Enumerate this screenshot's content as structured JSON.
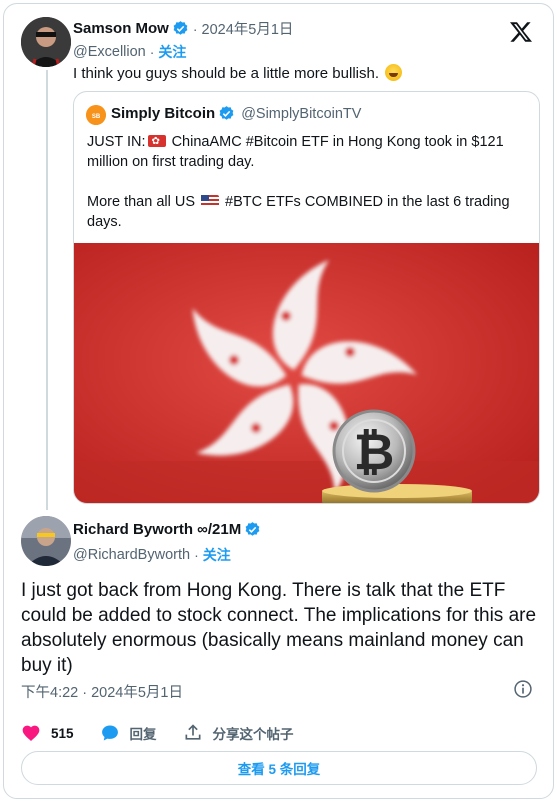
{
  "tweet": {
    "author_name": "Samson Mow",
    "author_handle": "@Excellion",
    "date": "2024年5月1日",
    "follow_label": "关注",
    "text": "I think you guys should be a little more bullish.",
    "emoji": "face-with-tears-of-joy"
  },
  "quoted_tweet": {
    "author_name": "Simply Bitcoin",
    "author_handle": "@SimplyBitcoinTV",
    "line1_pre": "JUST IN:",
    "line1_post": " ChinaAMC #Bitcoin ETF in Hong Kong took in $121",
    "line2": "million on first trading day.",
    "line3_pre": "More than all US ",
    "line3_post": " #BTC ETFs COMBINED in the last 6 trading",
    "line4": "days.",
    "image_description_icon": "hong-kong-flag-with-bitcoin"
  },
  "reply": {
    "author_name": "Richard Byworth ∞/21M",
    "author_handle": "@RichardByworth",
    "follow_label": "关注",
    "text": "I just got back from Hong Kong. There is talk that the ETF could be added to stock connect. The implications for this are absolutely enormous (basically means mainland money can buy it)",
    "timestamp": "下午4:22 · 2024年5月1日"
  },
  "actions": {
    "like_count": "515",
    "reply_label": "回复",
    "share_label": "分享这个帖子"
  },
  "view_replies_label": "查看 5 条回复",
  "colors": {
    "accent": "#1d9bf0",
    "like": "#f91880",
    "muted": "#536471",
    "border": "#cfd9de",
    "flag_red": "#d8322e"
  }
}
